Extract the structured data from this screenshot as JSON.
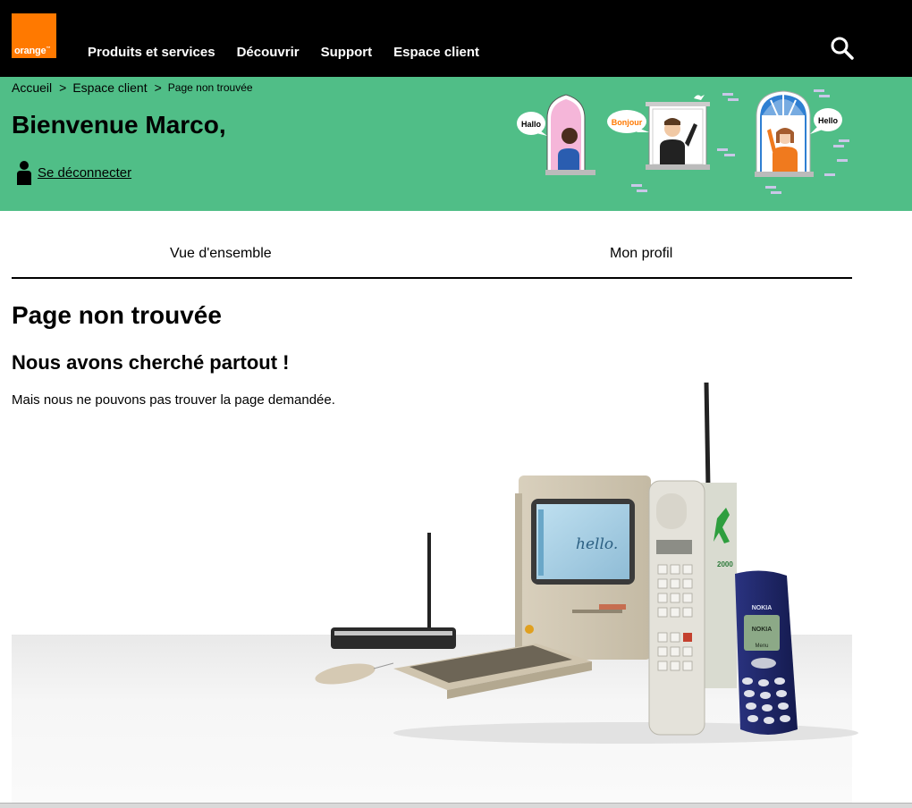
{
  "header": {
    "logo_text": "orange",
    "logo_tm": "™",
    "nav": [
      "Produits et services",
      "Découvrir",
      "Support",
      "Espace client"
    ],
    "brand_color": "#ff7900"
  },
  "banner": {
    "bg_color": "#50be87",
    "breadcrumbs": [
      "Accueil",
      "Espace client",
      "Page non trouvée"
    ],
    "breadcrumb_separator": ">",
    "welcome": "Bienvenue Marco,",
    "logout": "Se déconnecter",
    "bubbles": [
      "Hallo",
      "Bonjour",
      "Hello"
    ]
  },
  "tabs": [
    "Vue d'ensemble",
    "Mon profil"
  ],
  "content": {
    "title": "Page non trouvée",
    "subtitle": "Nous avons cherché partout !",
    "message": "Mais nous ne pouvons pas trouver la page demandée.",
    "screen_text": "hello.",
    "nokia_brand": "NOKIA",
    "nokia_screen": "NOKIA",
    "nokia_menu": "Menu",
    "pole_label": "2000"
  }
}
